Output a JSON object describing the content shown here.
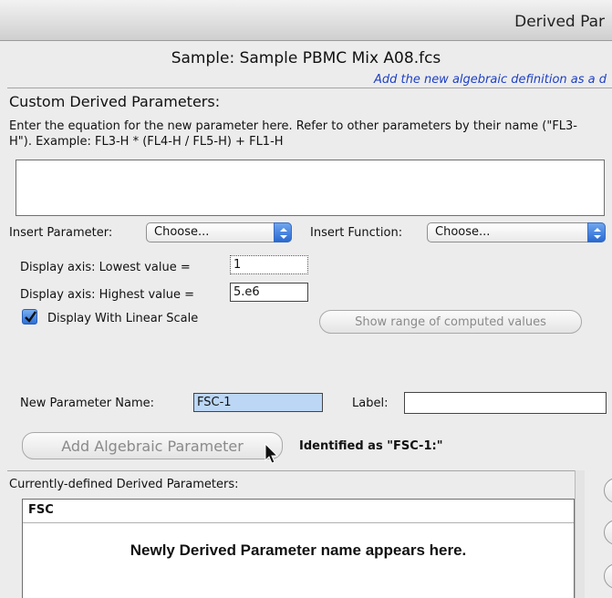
{
  "window": {
    "title": "Derived Par"
  },
  "sample": {
    "label": "Sample: Sample PBMC Mix A08.fcs"
  },
  "hint": {
    "text": "Add the new algebraic definition as a d"
  },
  "custom": {
    "title": "Custom Derived Parameters:",
    "instructions": "Enter the equation for the new parameter here.  Refer to other parameters by their name (\"FL3-H\").  Example:  FL3-H * (FL4-H / FL5-H) + FL1-H",
    "equation": ""
  },
  "insert_parameter": {
    "label": "Insert Parameter:",
    "value": "Choose..."
  },
  "insert_function": {
    "label": "Insert Function:",
    "value": "Choose..."
  },
  "axis": {
    "lowest_label": "Display axis: Lowest value =",
    "lowest_value": "1",
    "highest_label": "Display axis: Highest value =",
    "highest_value": "5.e6"
  },
  "linear_scale": {
    "label": "Display With Linear Scale",
    "checked": true
  },
  "show_range_button": "Show range of computed values",
  "new_param": {
    "name_label": "New Parameter Name:",
    "name_value": "FSC-1",
    "label_label": "Label:",
    "label_value": ""
  },
  "add_button": "Add Algebraic Parameter",
  "identified_text": "Identified as \"FSC-1:\"",
  "defined": {
    "label": "Currently-defined Derived Parameters:",
    "items": [
      "FSC"
    ],
    "note": "Newly Derived Parameter name appears here."
  },
  "colors": {
    "accent": "#2a69d1",
    "hint": "#1d3fc4",
    "selection": "#bcd7f5"
  }
}
